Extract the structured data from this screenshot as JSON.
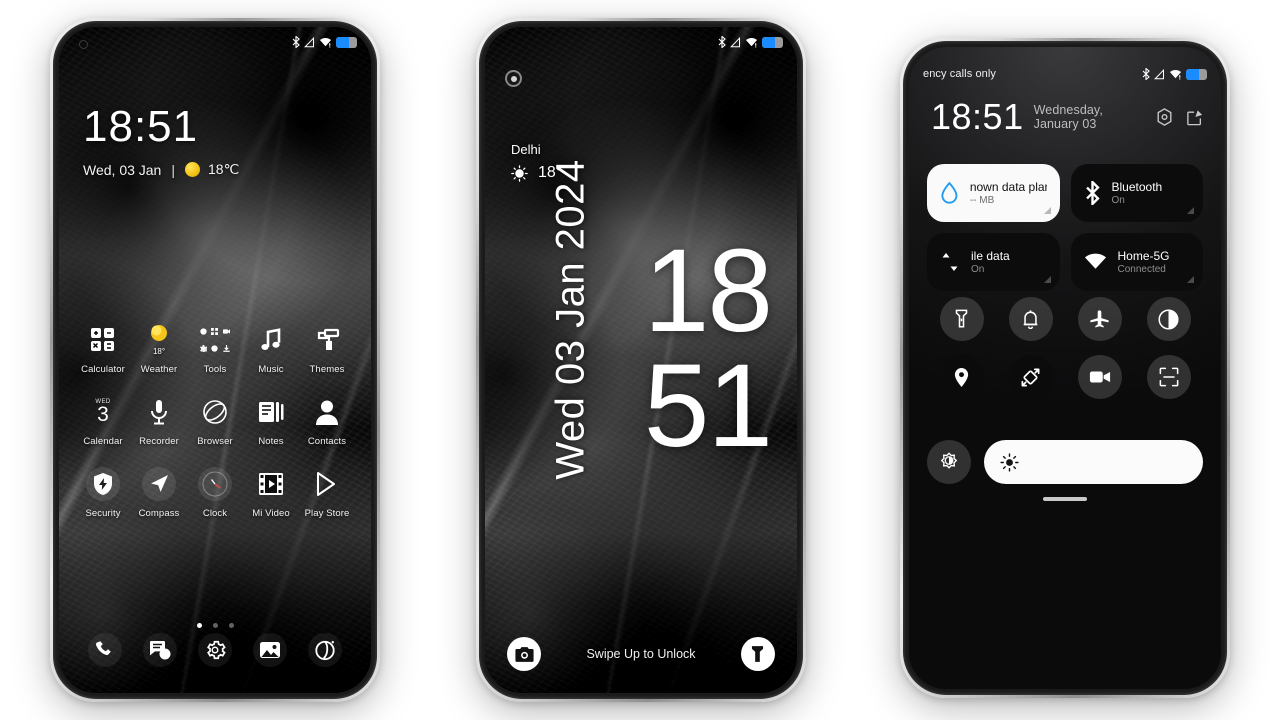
{
  "phone1": {
    "name": "home-screen",
    "statusbar": {
      "left_text": "",
      "icons": [
        "bluetooth-icon",
        "signal-none-icon",
        "wifi-alert-icon",
        "battery-icon"
      ]
    },
    "clock": {
      "time": "18:51",
      "date": "Wed, 03 Jan",
      "separator": "|",
      "temperature": "18℃",
      "weather_icon": "sun-icon"
    },
    "apps_row1": [
      {
        "label": "Calculator",
        "icon": "calculator-icon"
      },
      {
        "label": "Weather",
        "icon": "sun-icon",
        "badge": "18°"
      },
      {
        "label": "Tools",
        "icon": "folder-tools-icon"
      },
      {
        "label": "Music",
        "icon": "music-note-icon"
      },
      {
        "label": "Themes",
        "icon": "paint-roller-icon"
      }
    ],
    "apps_row2": [
      {
        "label": "Calendar",
        "icon": "calendar-icon",
        "weekday": "WED",
        "day": "3"
      },
      {
        "label": "Recorder",
        "icon": "microphone-icon"
      },
      {
        "label": "Browser",
        "icon": "browser-globe-icon"
      },
      {
        "label": "Notes",
        "icon": "notes-icon"
      },
      {
        "label": "Contacts",
        "icon": "person-icon"
      }
    ],
    "apps_row3": [
      {
        "label": "Security",
        "icon": "shield-bolt-icon"
      },
      {
        "label": "Compass",
        "icon": "compass-arrow-icon"
      },
      {
        "label": "Clock",
        "icon": "analog-clock-icon"
      },
      {
        "label": "Mi Video",
        "icon": "film-play-icon"
      },
      {
        "label": "Play Store",
        "icon": "play-store-icon"
      }
    ],
    "page_dots": {
      "count": 3,
      "active_index": 0
    },
    "dock": [
      {
        "label": "Phone",
        "icon": "phone-icon"
      },
      {
        "label": "Messages",
        "icon": "chat-bubbles-icon"
      },
      {
        "label": "Settings",
        "icon": "gear-icon"
      },
      {
        "label": "Gallery",
        "icon": "photo-icon"
      },
      {
        "label": "Camera",
        "icon": "aperture-icon"
      }
    ]
  },
  "phone2": {
    "name": "lock-screen",
    "statusbar": {
      "left_text": "",
      "icons": [
        "bluetooth-icon",
        "signal-none-icon",
        "wifi-alert-icon",
        "battery-icon"
      ]
    },
    "camera_ring": "camera-ring-icon",
    "weather": {
      "city": "Delhi",
      "temperature": "18°",
      "icon": "sun-icon"
    },
    "vertical_date": "Wed 03 Jan 2024",
    "time": {
      "hours": "18",
      "minutes": "51"
    },
    "bottom": {
      "left_icon": "camera-icon",
      "hint": "Swipe Up to Unlock",
      "right_icon": "flashlight-icon"
    }
  },
  "phone3": {
    "name": "control-center",
    "statusbar": {
      "left_text": "ency calls only",
      "icons": [
        "bluetooth-icon",
        "signal-none-icon",
        "wifi-alert-icon",
        "battery-icon"
      ]
    },
    "header": {
      "time": "18:51",
      "date": "Wednesday, January 03",
      "settings_icon": "gear-hex-icon",
      "edit_icon": "edit-pencil-icon"
    },
    "tiles": [
      {
        "title": "nown data plan",
        "subtitle": "-- MB",
        "icon": "data-drop-icon",
        "style": "light"
      },
      {
        "title": "Bluetooth",
        "subtitle": "On",
        "icon": "bluetooth-icon",
        "style": "dark"
      },
      {
        "title": "ile data",
        "subtitle": "On",
        "icon": "mobile-data-arrows-icon",
        "style": "dark"
      },
      {
        "title": "Home-5G",
        "subtitle": "Connected",
        "icon": "wifi-icon",
        "style": "dark"
      }
    ],
    "toggles": [
      {
        "name": "flashlight-toggle",
        "icon": "flashlight-icon",
        "state": "on"
      },
      {
        "name": "silent-toggle",
        "icon": "bell-icon",
        "state": "on"
      },
      {
        "name": "airplane-mode-toggle",
        "icon": "airplane-icon",
        "state": "on"
      },
      {
        "name": "dark-mode-toggle",
        "icon": "half-circle-icon",
        "state": "on"
      },
      {
        "name": "location-toggle",
        "icon": "location-pin-icon",
        "state": "off"
      },
      {
        "name": "auto-rotate-toggle",
        "icon": "rotate-icon",
        "state": "off"
      },
      {
        "name": "screen-recorder-toggle",
        "icon": "video-camera-icon",
        "state": "on"
      },
      {
        "name": "scanner-toggle",
        "icon": "scan-frame-icon",
        "state": "on"
      }
    ],
    "brightness": {
      "auto_icon": "auto-brightness-icon",
      "slider_icon": "brightness-sun-icon",
      "level": 100
    },
    "drag_handle": "drag-handle"
  },
  "colors": {
    "background": "#ffffff",
    "accent_blue": "#1a8cff",
    "weather_yellow": "#f5c518",
    "tile_light": "#fafafa",
    "tile_dark": "#0c0c0c"
  }
}
